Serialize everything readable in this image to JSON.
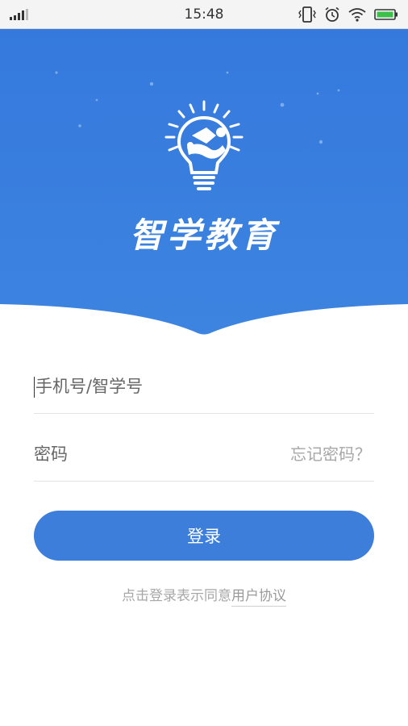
{
  "status_bar": {
    "time": "15:48",
    "icons": [
      "signal-icon",
      "vibrate-icon",
      "alarm-icon",
      "wifi-icon",
      "battery-icon"
    ]
  },
  "header": {
    "brand_name": "智学教育",
    "background_color": "#3b7fde",
    "logo": "lightbulb-graduation-icon"
  },
  "form": {
    "phone_placeholder": "手机号/智学号",
    "password_placeholder": "密码",
    "forgot_password": "忘记密码？"
  },
  "login_button": {
    "label": "登录",
    "color": "#3d7edb"
  },
  "agreement": {
    "prefix": "点击登录表示同意",
    "link": "用户协议"
  }
}
